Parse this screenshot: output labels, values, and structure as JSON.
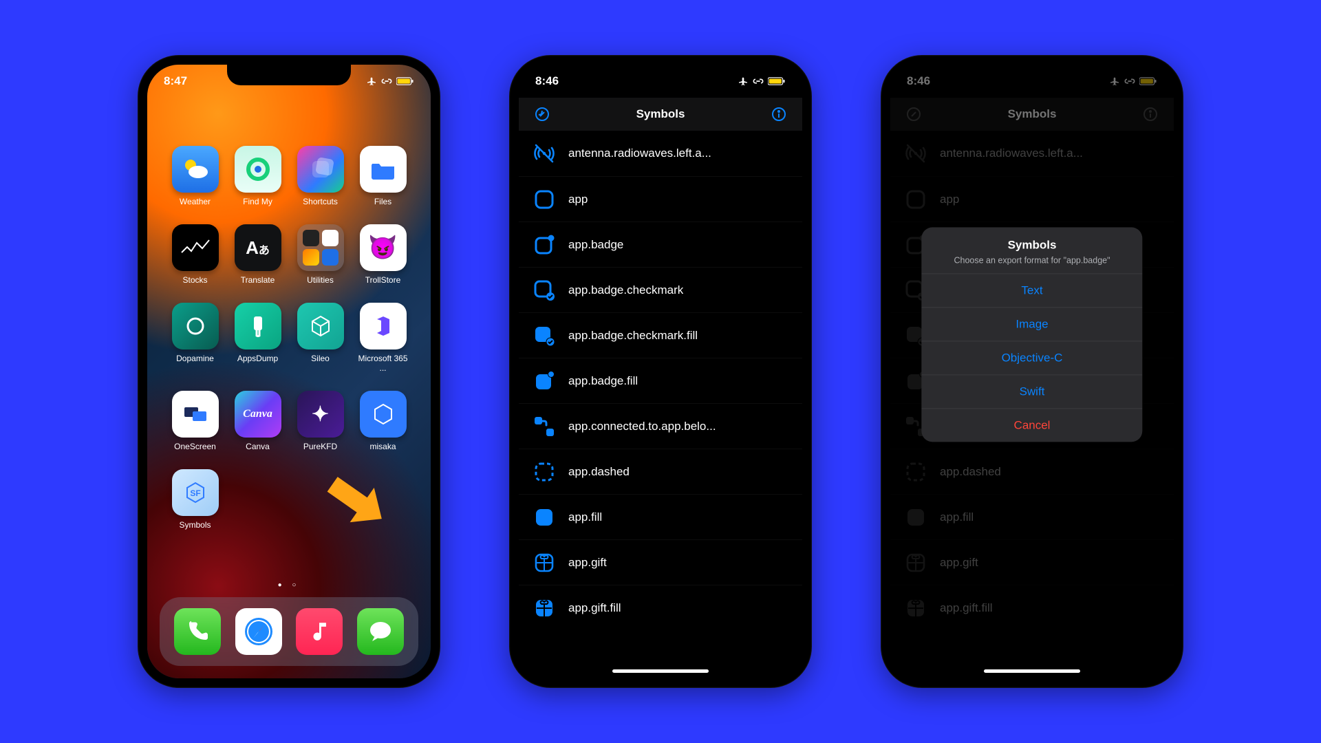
{
  "phone1": {
    "time": "8:47",
    "apps": [
      {
        "label": "Weather",
        "icon": "weather",
        "bg": "linear-gradient(180deg,#4aa8ff,#1e6fe6)"
      },
      {
        "label": "Find My",
        "icon": "findmy",
        "bg": "linear-gradient(180deg,#c8f6e5,#e9fef7)",
        "fg": "#18d07a"
      },
      {
        "label": "Shortcuts",
        "icon": "shortcuts",
        "bg": "linear-gradient(135deg,#ff3da7,#2f7bff 60%,#17d08a)"
      },
      {
        "label": "Files",
        "icon": "files",
        "bg": "#ffffff",
        "fg": "#2f7bff"
      },
      {
        "label": "Stocks",
        "icon": "stocks",
        "bg": "#000000",
        "fg": "#ffffff"
      },
      {
        "label": "Translate",
        "icon": "translate",
        "bg": "#111214",
        "fg": "#ffffff"
      },
      {
        "label": "Utilities",
        "icon": "utilities",
        "bg": "rgba(120,130,150,.35)",
        "fg": "#fff"
      },
      {
        "label": "TrollStore",
        "icon": "troll",
        "bg": "#ffffff",
        "fg": "#000"
      },
      {
        "label": "Dopamine",
        "icon": "dopamine",
        "bg": "linear-gradient(135deg,#0b9e8a,#085c51)"
      },
      {
        "label": "AppsDump",
        "icon": "appsdump",
        "bg": "linear-gradient(135deg,#16d0a8,#0aa481)"
      },
      {
        "label": "Sileo",
        "icon": "sileo",
        "bg": "linear-gradient(135deg,#1ec7b0,#12a493)"
      },
      {
        "label": "Microsoft 365 ...",
        "icon": "m365",
        "bg": "#ffffff",
        "fg": "#6b48ff"
      },
      {
        "label": "OneScreen",
        "icon": "onescreen",
        "bg": "#ffffff",
        "fg": "#1b2a5b"
      },
      {
        "label": "Canva",
        "icon": "canva",
        "bg": "linear-gradient(135deg,#2ad1e0,#6a3df5,#b03df5)"
      },
      {
        "label": "PureKFD",
        "icon": "purekfd",
        "bg": "linear-gradient(135deg,#2a1558,#4a1c97)"
      },
      {
        "label": "misaka",
        "icon": "misaka",
        "bg": "#2f7bff"
      },
      {
        "label": "Symbols",
        "icon": "symbols",
        "bg": "linear-gradient(135deg,#cfe8ff,#9fcdf7)",
        "fg": "#2f7bff"
      }
    ],
    "dock": [
      {
        "name": "phone-app",
        "bg": "linear-gradient(180deg,#6ee35a,#24b81e)"
      },
      {
        "name": "safari-app",
        "bg": "#ffffff"
      },
      {
        "name": "music-app",
        "bg": "linear-gradient(180deg,#ff4a6e,#ff2553)"
      },
      {
        "name": "messages-app",
        "bg": "linear-gradient(180deg,#6ee35a,#24b81e)"
      }
    ]
  },
  "symbols": {
    "time": "8:46",
    "title": "Symbols",
    "items": [
      {
        "id": "antenna.radiowaves.left.and.right.slash",
        "label": "antenna.radiowaves.left.a...",
        "icon": "antenna-slash"
      },
      {
        "id": "app",
        "label": "app",
        "icon": "app"
      },
      {
        "id": "app.badge",
        "label": "app.badge",
        "icon": "app-badge"
      },
      {
        "id": "app.badge.checkmark",
        "label": "app.badge.checkmark",
        "icon": "app-badge-check"
      },
      {
        "id": "app.badge.checkmark.fill",
        "label": "app.badge.checkmark.fill",
        "icon": "app-badge-check-fill"
      },
      {
        "id": "app.badge.fill",
        "label": "app.badge.fill",
        "icon": "app-badge-fill"
      },
      {
        "id": "app.connected.to.app.below.fill",
        "label": "app.connected.to.app.belo...",
        "icon": "app-connected"
      },
      {
        "id": "app.dashed",
        "label": "app.dashed",
        "icon": "app-dashed"
      },
      {
        "id": "app.fill",
        "label": "app.fill",
        "icon": "app-fill"
      },
      {
        "id": "app.gift",
        "label": "app.gift",
        "icon": "app-gift"
      },
      {
        "id": "app.gift.fill",
        "label": "app.gift.fill",
        "icon": "app-gift-fill"
      }
    ]
  },
  "sheet": {
    "title": "Symbols",
    "subtitle": "Choose an export format for \"app.badge\"",
    "options": [
      "Text",
      "Image",
      "Objective-C",
      "Swift"
    ],
    "cancel": "Cancel"
  }
}
